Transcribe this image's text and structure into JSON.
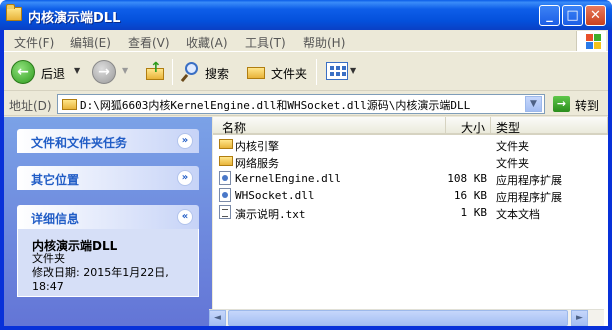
{
  "window": {
    "title": "内核演示端DLL",
    "minimize_glyph": "_",
    "maximize_glyph": "□",
    "close_glyph": "✕"
  },
  "menubar": {
    "items": [
      "文件(F)",
      "编辑(E)",
      "查看(V)",
      "收藏(A)",
      "工具(T)",
      "帮助(H)"
    ]
  },
  "toolbar": {
    "back_label": "后退",
    "search_label": "搜索",
    "folders_label": "文件夹",
    "back_icon": "back-arrow-icon",
    "forward_icon": "forward-arrow-icon",
    "up_icon": "folder-up-icon",
    "search_icon": "search-icon",
    "folders_icon": "folders-icon",
    "views_icon": "views-icon"
  },
  "addressbar": {
    "label": "地址(D)",
    "path": "D:\\网狐6603内核KernelEngine.dll和WHSocket.dll源码\\内核演示端DLL",
    "go_label": "转到"
  },
  "taskpane": {
    "file_tasks_title": "文件和文件夹任务",
    "other_places_title": "其它位置",
    "details_title": "详细信息",
    "detail_name": "内核演示端DLL",
    "detail_type": "文件夹",
    "detail_modified": "修改日期: 2015年1月22日, 18:47"
  },
  "listview": {
    "columns": {
      "name": "名称",
      "size": "大小",
      "type": "类型"
    },
    "rows": [
      {
        "name": "内核引擎",
        "size": "",
        "type": "文件夹",
        "icon": "folder-icon"
      },
      {
        "name": "网络服务",
        "size": "",
        "type": "文件夹",
        "icon": "folder-icon"
      },
      {
        "name": "KernelEngine.dll",
        "size": "108 KB",
        "type": "应用程序扩展",
        "icon": "dll-file-icon"
      },
      {
        "name": "WHSocket.dll",
        "size": "16 KB",
        "type": "应用程序扩展",
        "icon": "dll-file-icon"
      },
      {
        "name": "演示说明.txt",
        "size": "1 KB",
        "type": "文本文档",
        "icon": "text-file-icon"
      }
    ]
  },
  "colors": {
    "titlebar": "#0450db",
    "taskpane": "#6f8ee0",
    "panel_title": "#215dc6"
  }
}
